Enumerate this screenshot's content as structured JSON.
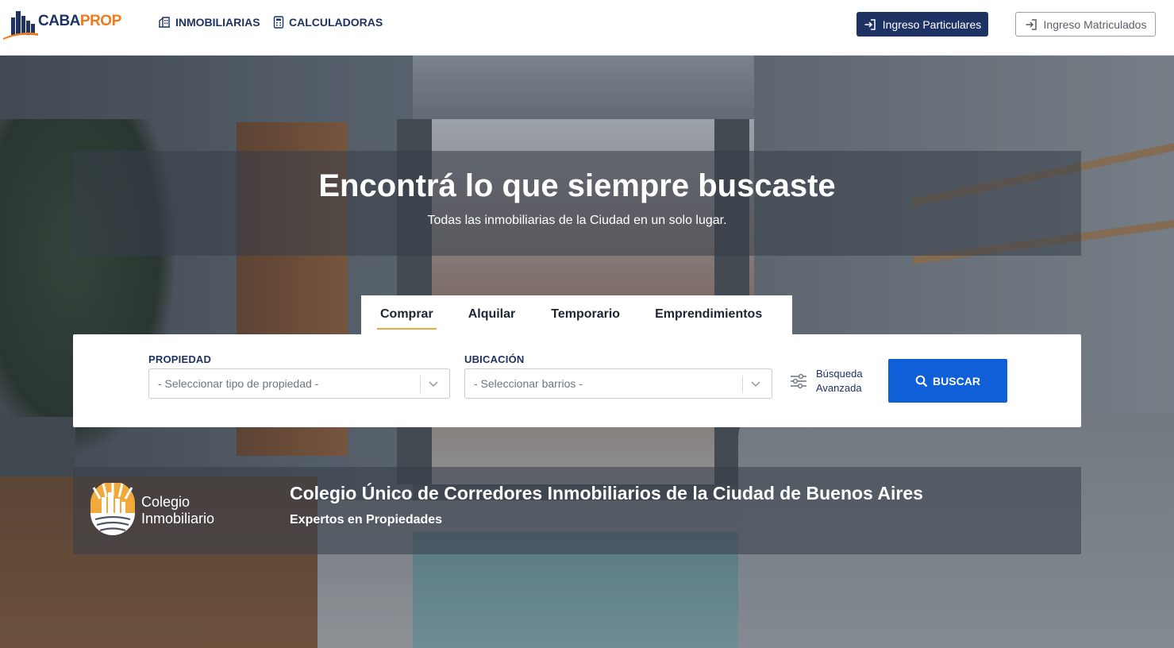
{
  "header": {
    "logo_text_part1": "CABA",
    "logo_text_part2": "PROP",
    "nav": {
      "inmobiliarias": "INMOBILIARIAS",
      "calculadoras": "CALCULADORAS"
    },
    "login_particulares": "Ingreso Particulares",
    "login_matriculados": "Ingreso Matriculados"
  },
  "hero": {
    "title": "Encontrá lo que siempre buscaste",
    "subtitle": "Todas las inmobiliarias de la Ciudad en un solo lugar."
  },
  "tabs": [
    {
      "label": "Comprar",
      "active": true
    },
    {
      "label": "Alquilar",
      "active": false
    },
    {
      "label": "Temporario",
      "active": false
    },
    {
      "label": "Emprendimientos",
      "active": false
    }
  ],
  "search": {
    "property_label": "PROPIEDAD",
    "property_placeholder": "- Seleccionar tipo de propiedad -",
    "location_label": "UBICACIÓN",
    "location_placeholder": "- Seleccionar barrios -",
    "advanced_line1": "Búsqueda",
    "advanced_line2": "Avanzada",
    "search_button": "BUSCAR"
  },
  "colegio": {
    "logo_line1": "Colegio",
    "logo_line2": "Inmobiliario",
    "title": "Colegio Único de Corredores Inmobiliarios de la Ciudad de Buenos Aires",
    "subtitle": "Expertos en Propiedades"
  },
  "colors": {
    "brand_navy": "#1e3264",
    "brand_orange": "#f07a1e",
    "primary_button": "#0f5fd8",
    "tab_underline": "#f2a93b"
  },
  "icons": [
    "building-icon",
    "calculator-icon",
    "login-icon",
    "chevron-down-icon",
    "sliders-icon",
    "search-icon",
    "colegio-logo-icon"
  ]
}
